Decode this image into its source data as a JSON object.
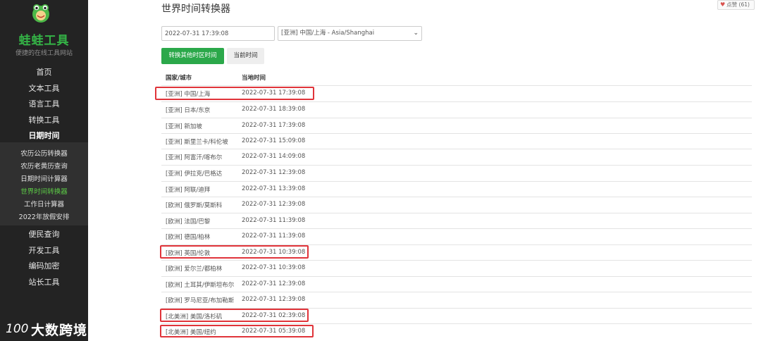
{
  "brand": {
    "name": "蛙蛙工具",
    "slogan": "便捷的在线工具网站"
  },
  "nav": {
    "main_top": [
      "首页",
      "文本工具",
      "语言工具",
      "转换工具",
      "日期时间"
    ],
    "sub": [
      "农历公历转换器",
      "农历老黄历查询",
      "日期时间计算器",
      "世界时间转换器",
      "工作日计算器",
      "2022年放假安排"
    ],
    "main_bottom": [
      "便民查询",
      "开发工具",
      "编码加密",
      "站长工具"
    ]
  },
  "watermark": {
    "text": "大数跨境",
    "logo_text": "100"
  },
  "page": {
    "title": "世界时间转换器",
    "like_label": "点赞 (61)",
    "time_input_value": "2022-07-31 17:39:08",
    "zone_select_value": "[亚洲] 中国/上海 - Asia/Shanghai",
    "convert_button": "转换其他时区时间",
    "now_button": "当前时间"
  },
  "table": {
    "headers": [
      "国家/城市",
      "当地时间"
    ],
    "rows": [
      {
        "city": "[亚洲] 中国/上海",
        "time": "2022-07-31 17:39:08"
      },
      {
        "city": "[亚洲] 日本/东京",
        "time": "2022-07-31 18:39:08"
      },
      {
        "city": "[亚洲] 新加坡",
        "time": "2022-07-31 17:39:08"
      },
      {
        "city": "[亚洲] 斯里兰卡/科伦坡",
        "time": "2022-07-31 15:09:08"
      },
      {
        "city": "[亚洲] 阿富汗/喀布尔",
        "time": "2022-07-31 14:09:08"
      },
      {
        "city": "[亚洲] 伊拉克/巴格达",
        "time": "2022-07-31 12:39:08"
      },
      {
        "city": "[亚洲] 阿联/迪拜",
        "time": "2022-07-31 13:39:08"
      },
      {
        "city": "[欧洲] 俄罗斯/莫斯科",
        "time": "2022-07-31 12:39:08"
      },
      {
        "city": "[欧洲] 法国/巴黎",
        "time": "2022-07-31 11:39:08"
      },
      {
        "city": "[欧洲] 德国/柏林",
        "time": "2022-07-31 11:39:08"
      },
      {
        "city": "[欧洲] 英国/伦敦",
        "time": "2022-07-31 10:39:08"
      },
      {
        "city": "[欧洲] 爱尔兰/都柏林",
        "time": "2022-07-31 10:39:08"
      },
      {
        "city": "[欧洲] 土耳其/伊斯坦布尔",
        "time": "2022-07-31 12:39:08"
      },
      {
        "city": "[欧洲] 罗马尼亚/布加勒斯",
        "time": "2022-07-31 12:39:08"
      },
      {
        "city": "[北美洲] 美国/洛杉矶",
        "time": "2022-07-31 02:39:08"
      },
      {
        "city": "[北美洲] 美国/纽约",
        "time": "2022-07-31 05:39:08"
      }
    ]
  },
  "colors": {
    "sidebar_bg": "#232323",
    "brand_green": "#34b346",
    "button_green": "#2ba84a",
    "highlight_red": "#e0343a"
  }
}
